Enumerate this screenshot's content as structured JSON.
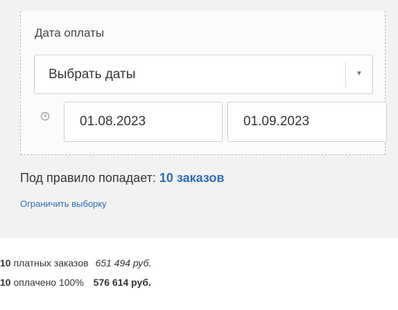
{
  "filter": {
    "label": "Дата оплаты",
    "select_value": "Выбрать даты",
    "date_from": "01.08.2023",
    "date_to": "01.09.2023"
  },
  "rule": {
    "prefix": "Под правило попадает:",
    "count_text": "10 заказов",
    "limit_link": "Ограничить выборку"
  },
  "stats": {
    "paid": {
      "count": "10",
      "label": "платных заказов",
      "sum": "651 494 руб."
    },
    "fully_paid": {
      "count": "10",
      "label": "оплачено 100%",
      "sum": "576 614 руб."
    }
  },
  "icons": {
    "clock": "clock-icon",
    "dropdown": "chevron-down-icon"
  },
  "colors": {
    "link": "#2f6eb5",
    "panel_bg": "#f2f2f2"
  }
}
